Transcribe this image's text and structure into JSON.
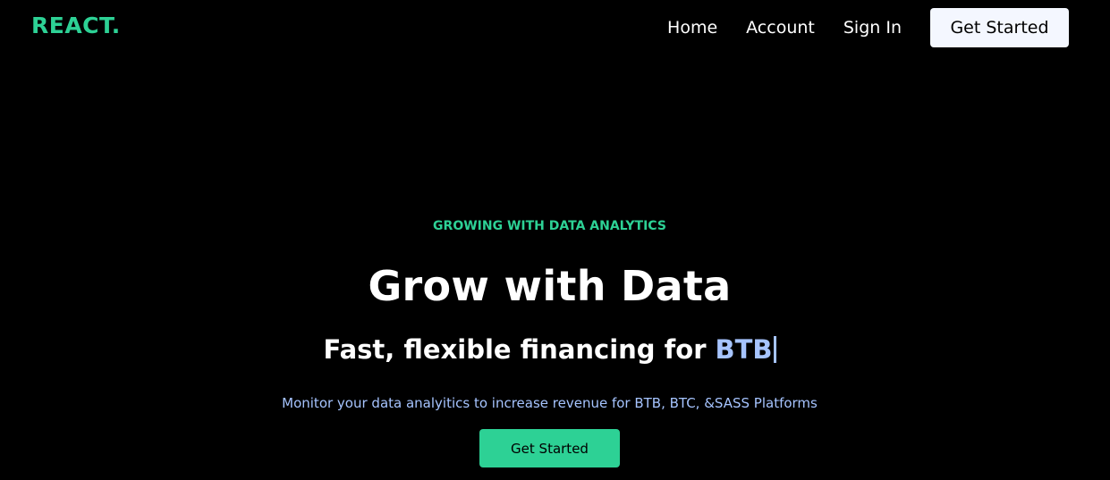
{
  "header": {
    "logo": "REACT.",
    "nav": {
      "home": "Home",
      "account": "Account",
      "sign_in": "Sign In",
      "get_started": "Get Started"
    }
  },
  "hero": {
    "eyebrow": "GROWING WITH DATA ANALYTICS",
    "headline": "Grow with Data",
    "subheadline_prefix": "Fast, flexible financing for",
    "subheadline_typed": "BTB",
    "tagline": "Monitor your data analyitics to increase revenue for BTB, BTC, &SASS Platforms",
    "cta": "Get Started"
  },
  "colors": {
    "background": "#000000",
    "accent_green": "#2dd195",
    "accent_blue": "#a6c4ff",
    "text": "#ffffff",
    "nav_button_bg": "#f4f7ff"
  }
}
